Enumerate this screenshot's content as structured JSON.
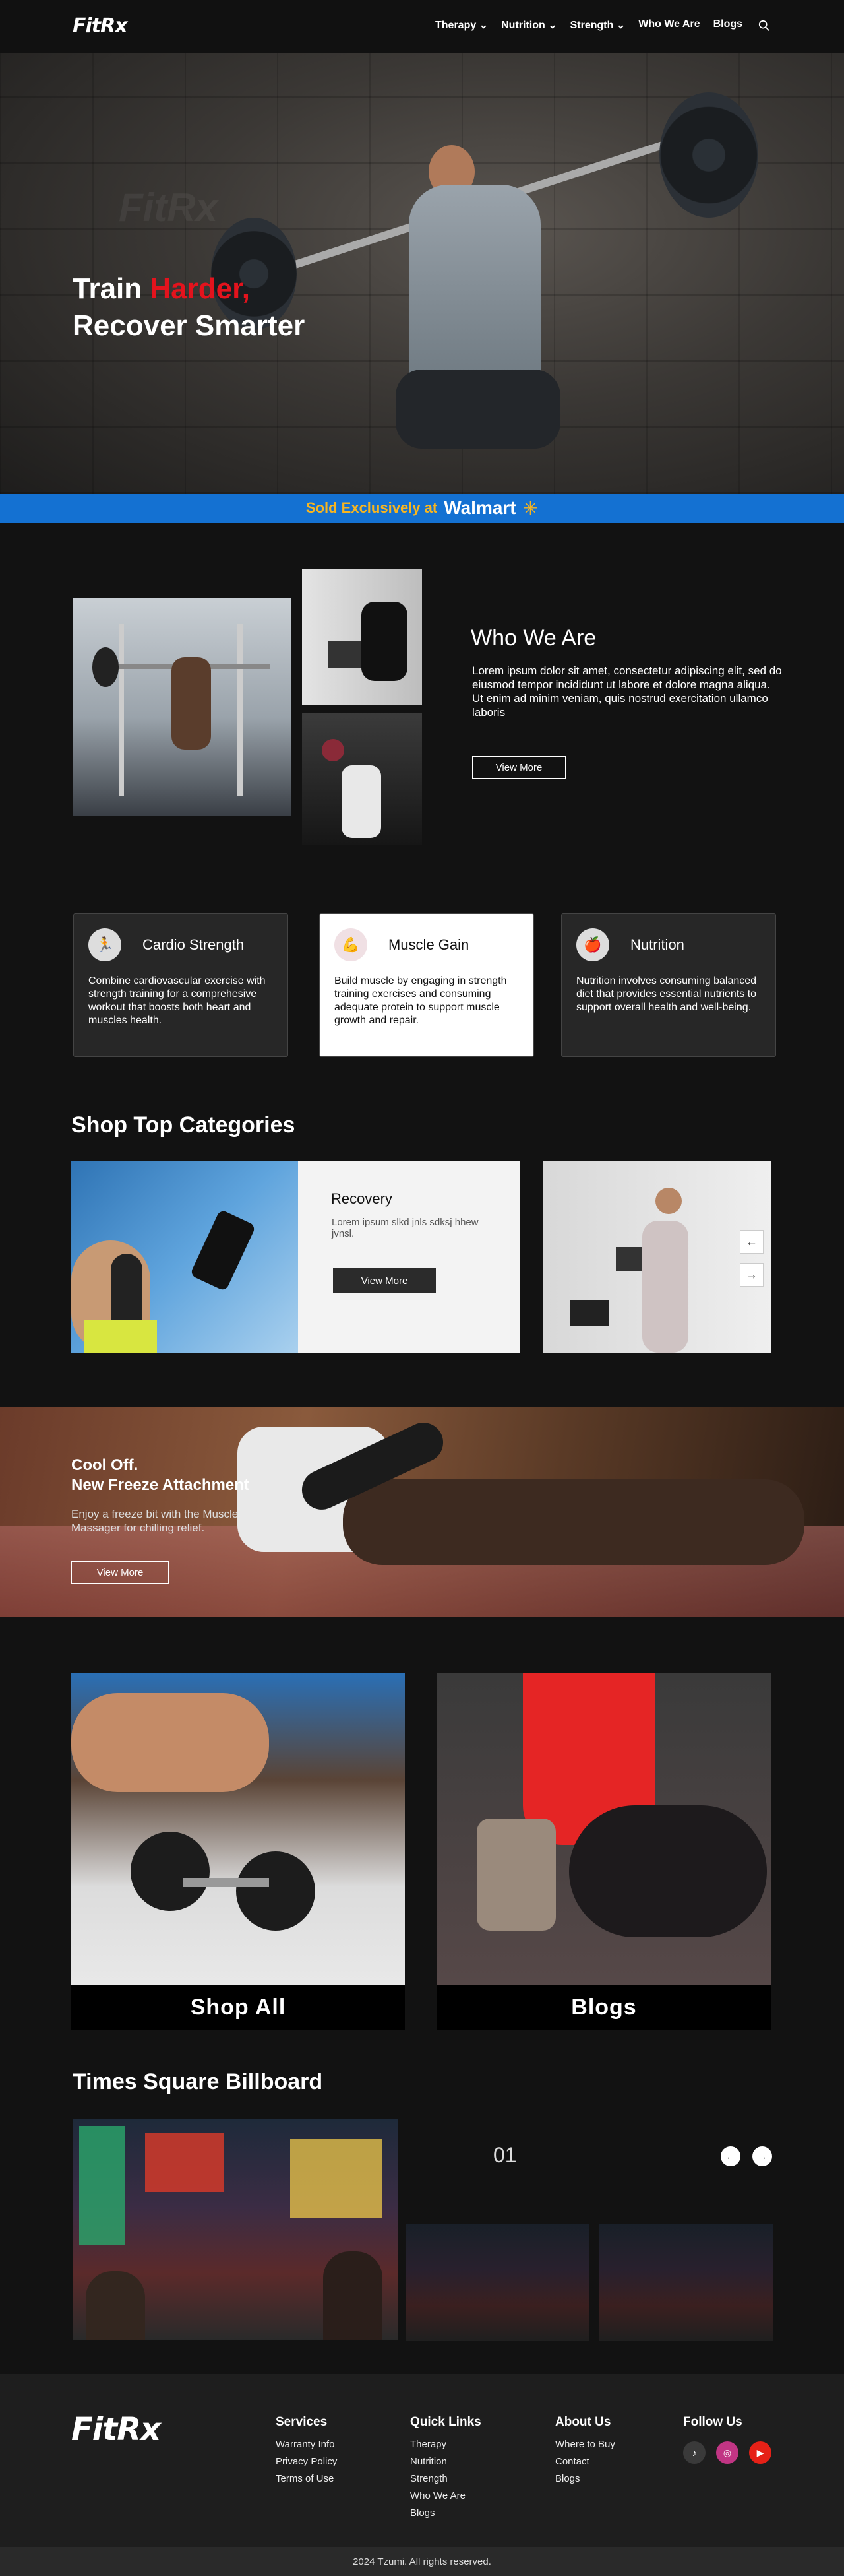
{
  "nav": {
    "logo_main": "FitR",
    "logo_x": "x",
    "menu": [
      {
        "label": "Therapy",
        "has_dropdown": true
      },
      {
        "label": "Nutrition",
        "has_dropdown": true
      },
      {
        "label": "Strength",
        "has_dropdown": true
      },
      {
        "label": "Who We Are",
        "has_dropdown": false
      },
      {
        "label": "Blogs",
        "has_dropdown": false
      }
    ],
    "search_icon": "search-icon"
  },
  "hero": {
    "line1_white": "Train ",
    "line1_red": "Harder,",
    "line2": "Recover Smarter",
    "watermark": "FitRx"
  },
  "walmart": {
    "sold_text": "Sold Exclusively at",
    "brand": "Walmart",
    "spark": "✳"
  },
  "who": {
    "title": "Who We Are",
    "text": "Lorem ipsum dolor sit amet, consectetur adipiscing elit, sed do eiusmod tempor incididunt ut labore et dolore magna aliqua. Ut enim ad minim veniam, quis nostrud exercitation ullamco laboris",
    "button": "View More"
  },
  "features": [
    {
      "title": "Cardio Strength",
      "icon": "runner-icon",
      "desc": "Combine cardiovascular exercise with strength training for a comprehesive workout that boosts both heart and muscles health."
    },
    {
      "title": "Muscle Gain",
      "icon": "muscle-icon",
      "desc": "Build muscle by engaging in strength training exercises and consuming adequate protein to support muscle growth and repair."
    },
    {
      "title": "Nutrition",
      "icon": "nutrition-icon",
      "desc": "Nutrition involves consuming balanced diet that provides essential nutrients to support overall health and well-being."
    }
  ],
  "categories": {
    "title": "Shop Top Categories",
    "featured": {
      "name": "Recovery",
      "desc": "Lorem ipsum slkd jnls sdksj hhew jvnsl.",
      "button": "View More"
    },
    "prev": "←",
    "next": "→"
  },
  "promo": {
    "title_line1": "Cool Off.",
    "title_line2": "New Freeze Attachment",
    "text": "Enjoy a freeze bit with the Muscle Massager for chilling relief.",
    "button": "View More"
  },
  "tiles": [
    {
      "label": "Shop All"
    },
    {
      "label": "Blogs"
    }
  ],
  "billboard": {
    "title": "Times Square Billboard",
    "counter": "01",
    "prev": "←",
    "next": "→"
  },
  "footer": {
    "logo_main": "FitR",
    "logo_x": "x",
    "columns": [
      {
        "title": "Services",
        "links": [
          "Warranty Info",
          "Privacy Policy",
          "Terms of Use"
        ]
      },
      {
        "title": "Quick Links",
        "links": [
          "Therapy",
          "Nutrition",
          "Strength",
          "Who We Are",
          "Blogs"
        ]
      },
      {
        "title": "About Us",
        "links": [
          "Where to Buy",
          "Contact",
          "Blogs"
        ]
      }
    ],
    "follow_title": "Follow Us",
    "social": [
      {
        "icon": "tiktok-icon",
        "glyph": "♪",
        "color": "#3a3a3a"
      },
      {
        "icon": "instagram-icon",
        "glyph": "◎",
        "color": "#c13584"
      },
      {
        "icon": "youtube-icon",
        "glyph": "▶",
        "color": "#e62117"
      }
    ],
    "copyright": "2024 Tzumi. All rights reserved."
  }
}
